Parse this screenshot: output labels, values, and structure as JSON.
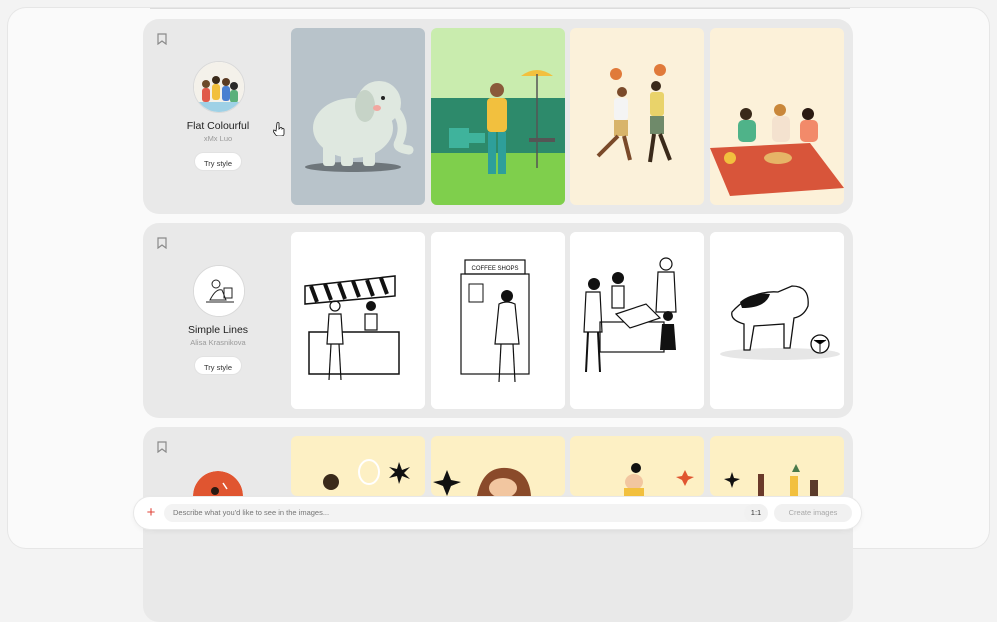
{
  "rows": [
    {
      "style_name": "Flat Colourful",
      "author": "xMx Luo",
      "button": "Try style",
      "thumb_bg": [
        "#b8c3ca",
        "#c9ecae",
        "#fbf1da",
        "#fcf1d9"
      ]
    },
    {
      "style_name": "Simple Lines",
      "author": "Alisa Krasnikova",
      "button": "Try style",
      "thumb_bg": [
        "#ffffff",
        "#ffffff",
        "#ffffff",
        "#ffffff"
      ],
      "thumb_text": "COFFEE SHOPS"
    },
    {
      "thumb_bg": [
        "#fdf0c4",
        "#fdf0c4",
        "#fdf0c4",
        "#fdf0c4"
      ],
      "avatar_color": "#e05530"
    }
  ],
  "prompt": {
    "placeholder": "Describe what you'd like to see in the images..."
  },
  "aspect_ratio": "1:1",
  "create_label": "Create images",
  "colors": {
    "accent": "#e0443a"
  }
}
